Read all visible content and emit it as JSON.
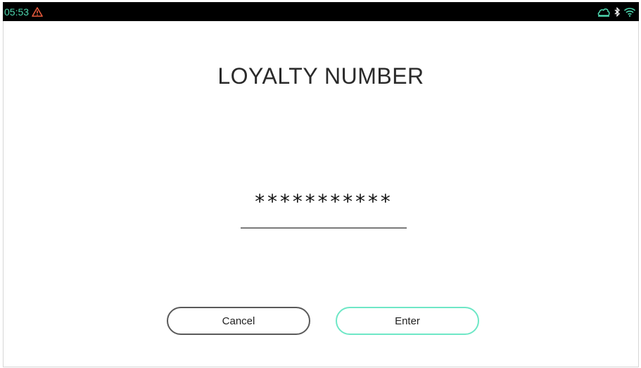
{
  "status_bar": {
    "time": "05:53",
    "warning_icon": "warning-triangle-icon",
    "cloud_icon": "cloud-icon",
    "bluetooth_icon": "bluetooth-icon",
    "wifi_icon": "wifi-icon"
  },
  "colors": {
    "accent": "#4ed9b0",
    "warning": "#e85a3c",
    "enter_border": "#6ee7c6",
    "cancel_border": "#5a5a5a"
  },
  "screen": {
    "title": "LOYALTY NUMBER",
    "masked_value": "***********"
  },
  "buttons": {
    "cancel_label": "Cancel",
    "enter_label": "Enter"
  }
}
